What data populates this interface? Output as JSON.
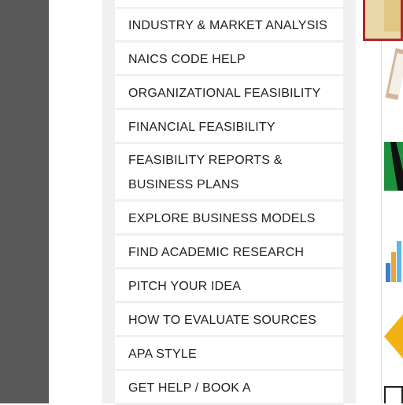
{
  "nav": {
    "items": [
      {
        "label": "INDUSTRY & MARKET ANALYSIS"
      },
      {
        "label": "NAICS CODE HELP"
      },
      {
        "label": "ORGANIZATIONAL FEASIBILITY"
      },
      {
        "label": "FINANCIAL FEASIBILITY"
      },
      {
        "label": "FEASIBILITY REPORTS & BUSINESS PLANS"
      },
      {
        "label": "EXPLORE BUSINESS MODELS"
      },
      {
        "label": "FIND ACADEMIC RESEARCH"
      },
      {
        "label": "PITCH YOUR IDEA"
      },
      {
        "label": "HOW TO EVALUATE SOURCES"
      },
      {
        "label": "APA STYLE"
      },
      {
        "label": "GET HELP / BOOK A"
      }
    ]
  },
  "colors": {
    "gutter": "#595959",
    "panel_background": "#f0f0f0",
    "item_background": "#ffffff",
    "item_text": "#222222",
    "highlight_border": "#b0282b"
  }
}
